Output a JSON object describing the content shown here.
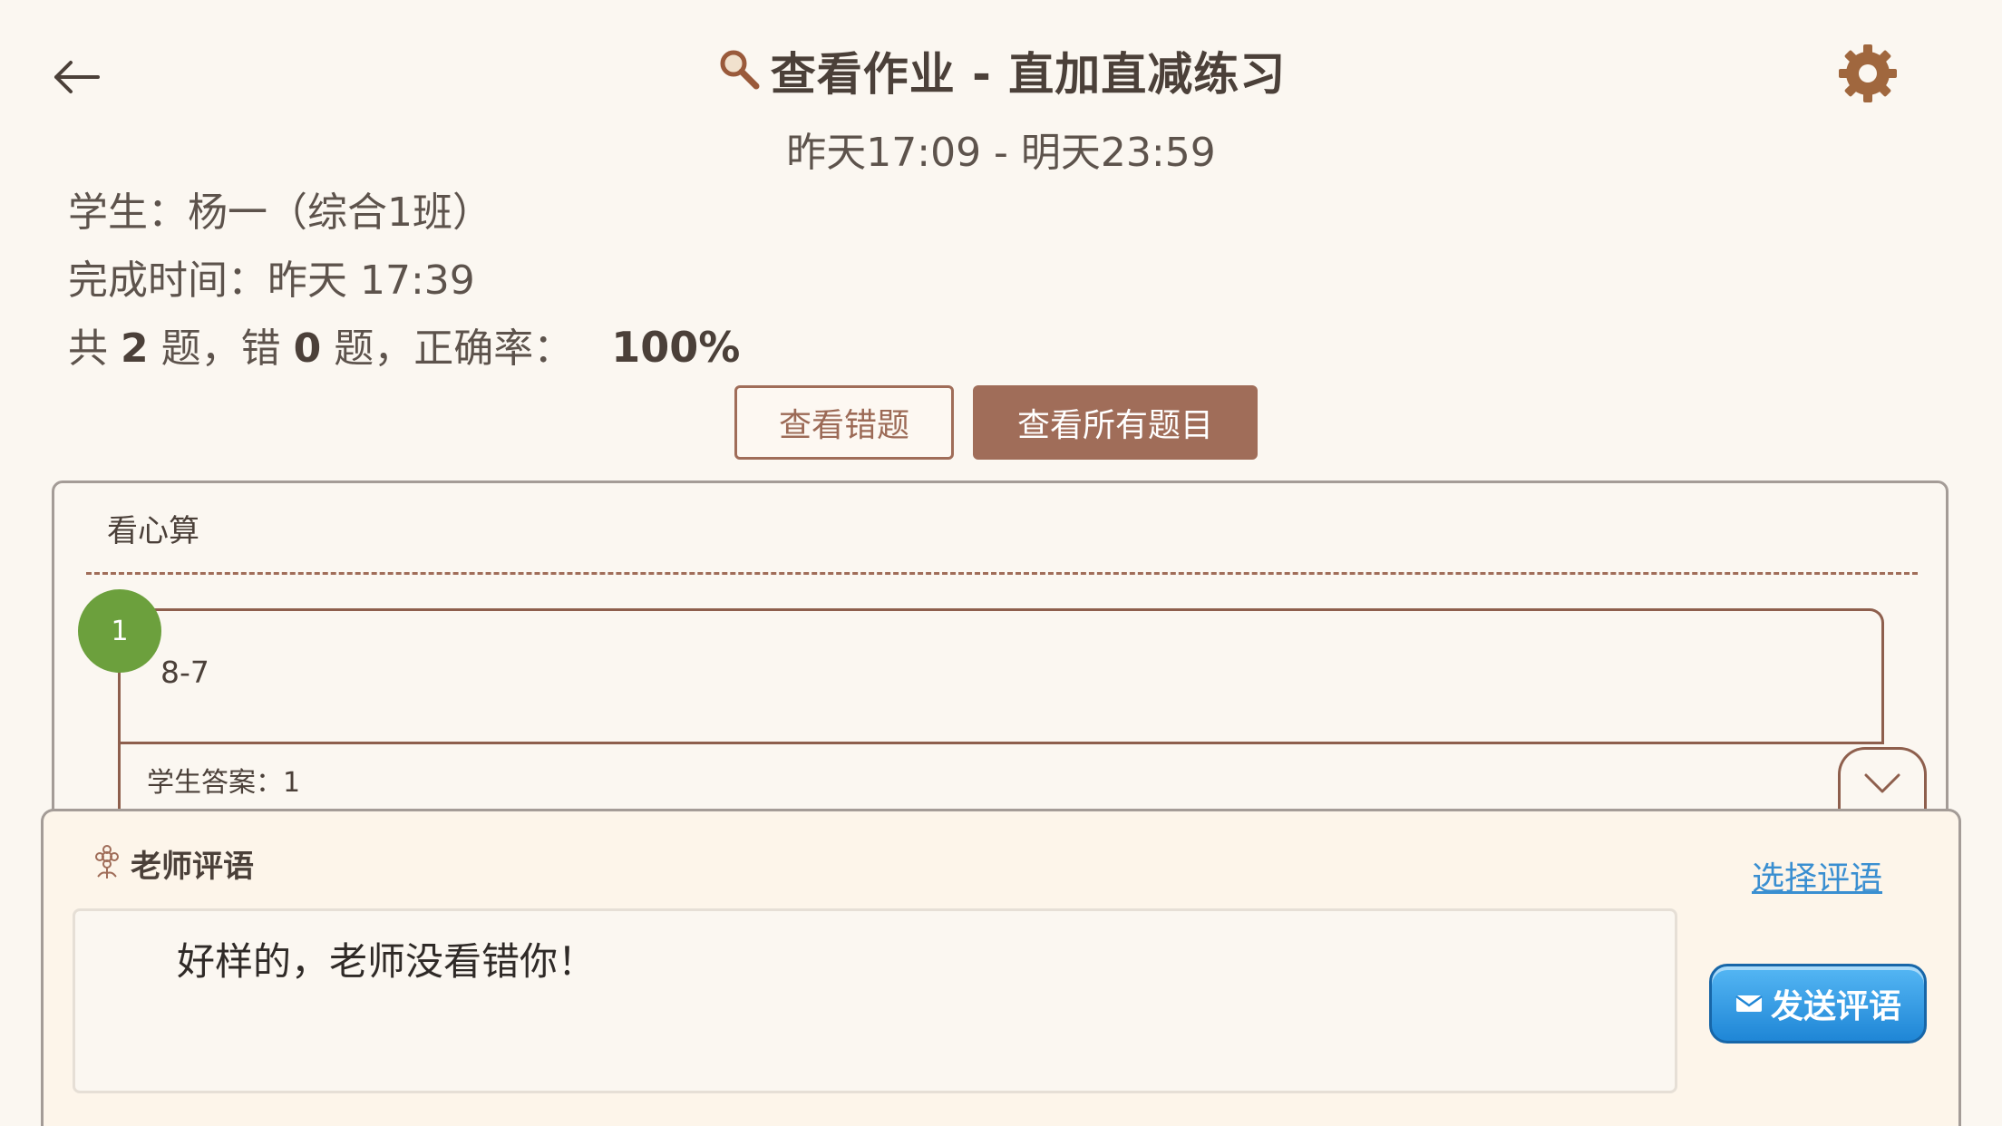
{
  "header": {
    "title": "查看作业 - 直加直减练习",
    "time_range": "昨天17:09 - 明天23:59"
  },
  "info": {
    "student": "学生：杨一（综合1班）",
    "done_time": "完成时间：昨天 17:39",
    "stats": {
      "prefix": "共",
      "total": "2",
      "mid1": "题，错",
      "wrong": "0",
      "mid2": "题，正确率：",
      "accuracy": "100%"
    }
  },
  "buttons": {
    "view_wrong": "查看错题",
    "view_all": "查看所有题目"
  },
  "section": {
    "title": "看心算",
    "question": {
      "number": "1",
      "text": "8-7",
      "answer": "学生答案：1"
    }
  },
  "comment": {
    "label": "老师评语",
    "choose": "选择评语",
    "value": "好样的，老师没看错你！",
    "send": "发送评语"
  },
  "colors": {
    "background": "#fbf7f1",
    "accent": "#a06d59",
    "badge_green": "#6ca03d",
    "link_blue": "#3a8fd1"
  }
}
